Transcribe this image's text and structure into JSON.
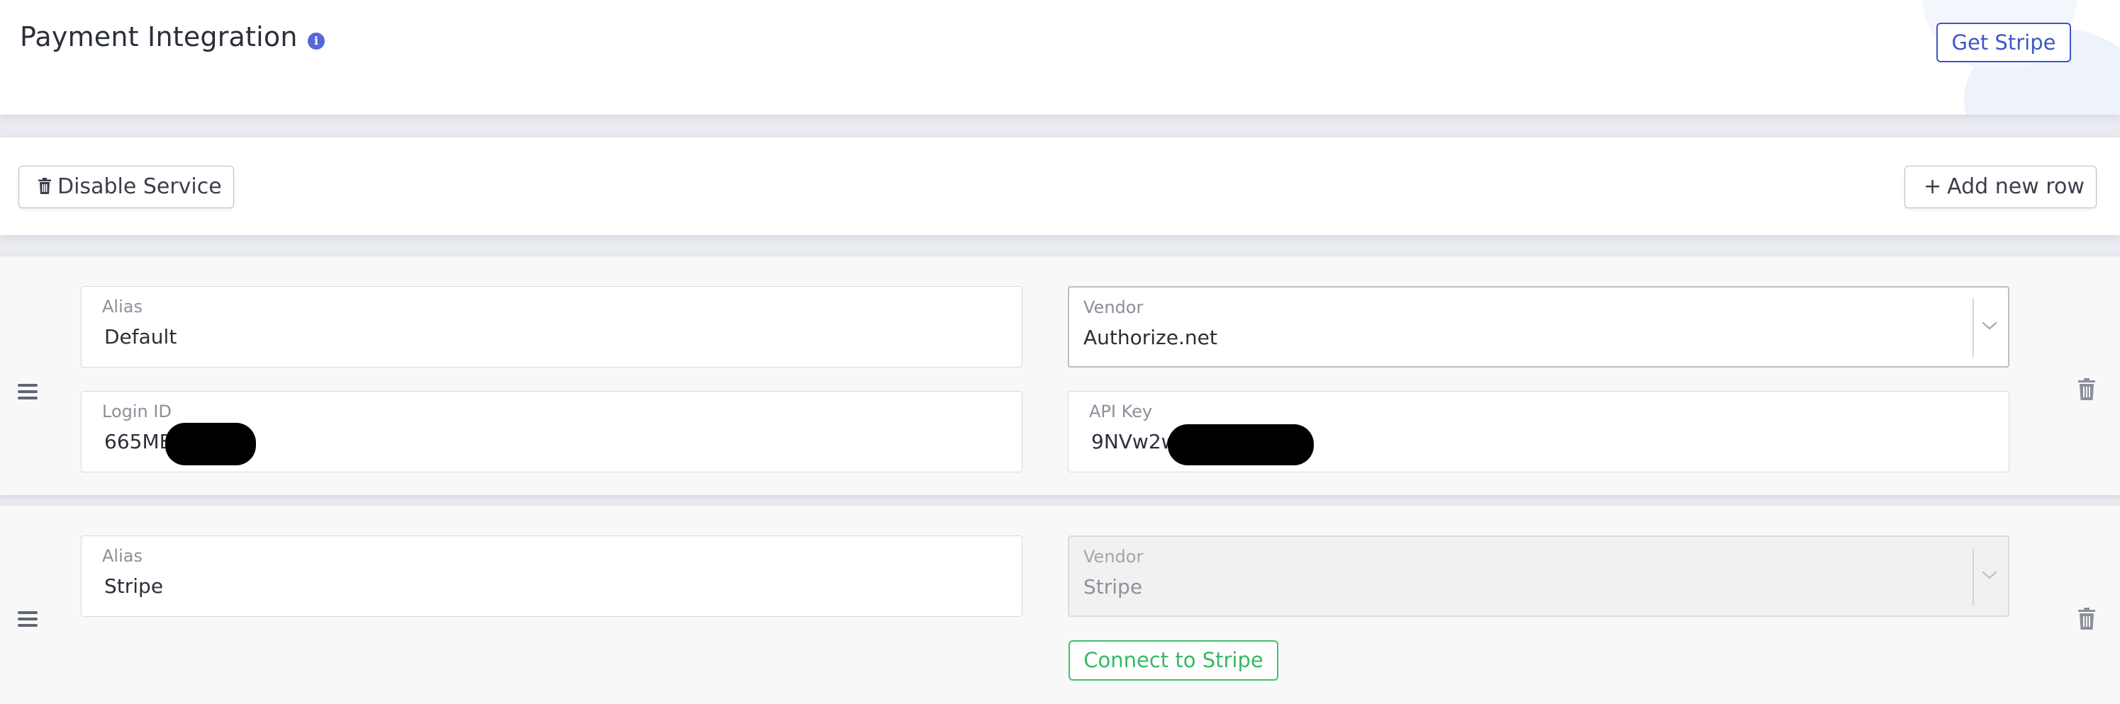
{
  "header": {
    "title": "Payment Integration",
    "info_icon": "i",
    "get_stripe_label": "Get Stripe"
  },
  "toolbar": {
    "disable_label": "Disable Service",
    "add_label": "Add new row",
    "add_icon": "+"
  },
  "rows": [
    {
      "alias": {
        "label": "Alias",
        "value": "Default"
      },
      "vendor": {
        "label": "Vendor",
        "value": "Authorize.net"
      },
      "login_id": {
        "label": "Login ID",
        "value": "665MB"
      },
      "api_key": {
        "label": "API Key",
        "value": "9NVw2w"
      }
    },
    {
      "alias": {
        "label": "Alias",
        "value": "Stripe"
      },
      "vendor": {
        "label": "Vendor",
        "value": "Stripe"
      },
      "connect_label": "Connect to Stripe"
    }
  ],
  "colors": {
    "accent": "#3d57c7",
    "info": "#5468d8",
    "success": "#38b866",
    "redaction": "#000000"
  },
  "icons": [
    "info-icon",
    "trash-icon",
    "plus-icon",
    "drag-handle-icon",
    "chevron-down-icon"
  ]
}
